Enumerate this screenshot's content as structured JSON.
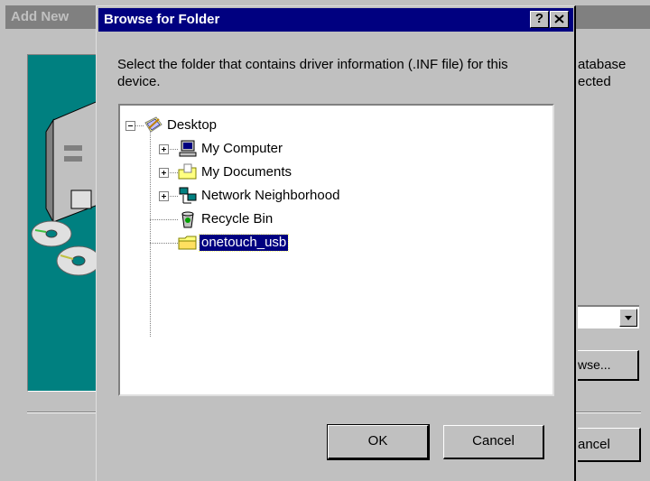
{
  "background_window": {
    "title": "Add New",
    "text_lines": [
      "atabase",
      "ected"
    ],
    "combo_arrow": "chevron-down-icon",
    "browse_label": "wse...",
    "cancel_label": "ancel"
  },
  "dialog": {
    "title": "Browse for Folder",
    "help_label": "?",
    "description": "Select the folder that contains driver information (.INF file) for this device.",
    "ok_label": "OK",
    "cancel_label": "Cancel"
  },
  "tree": {
    "root": {
      "label": "Desktop",
      "icon": "desktop-icon",
      "expanded": true
    },
    "items": [
      {
        "label": "My Computer",
        "icon": "computer-icon",
        "expandable": true
      },
      {
        "label": "My Documents",
        "icon": "documents-folder-icon",
        "expandable": true
      },
      {
        "label": "Network Neighborhood",
        "icon": "network-icon",
        "expandable": true
      },
      {
        "label": "Recycle Bin",
        "icon": "recycle-bin-icon",
        "expandable": false
      },
      {
        "label": "onetouch_usb",
        "icon": "folder-icon",
        "expandable": false,
        "selected": true
      }
    ]
  },
  "colors": {
    "titlebar_active": "#000080",
    "titlebar_inactive": "#808080",
    "face": "#c0c0c0",
    "wizard_panel": "#008080",
    "selection": "#000080"
  }
}
